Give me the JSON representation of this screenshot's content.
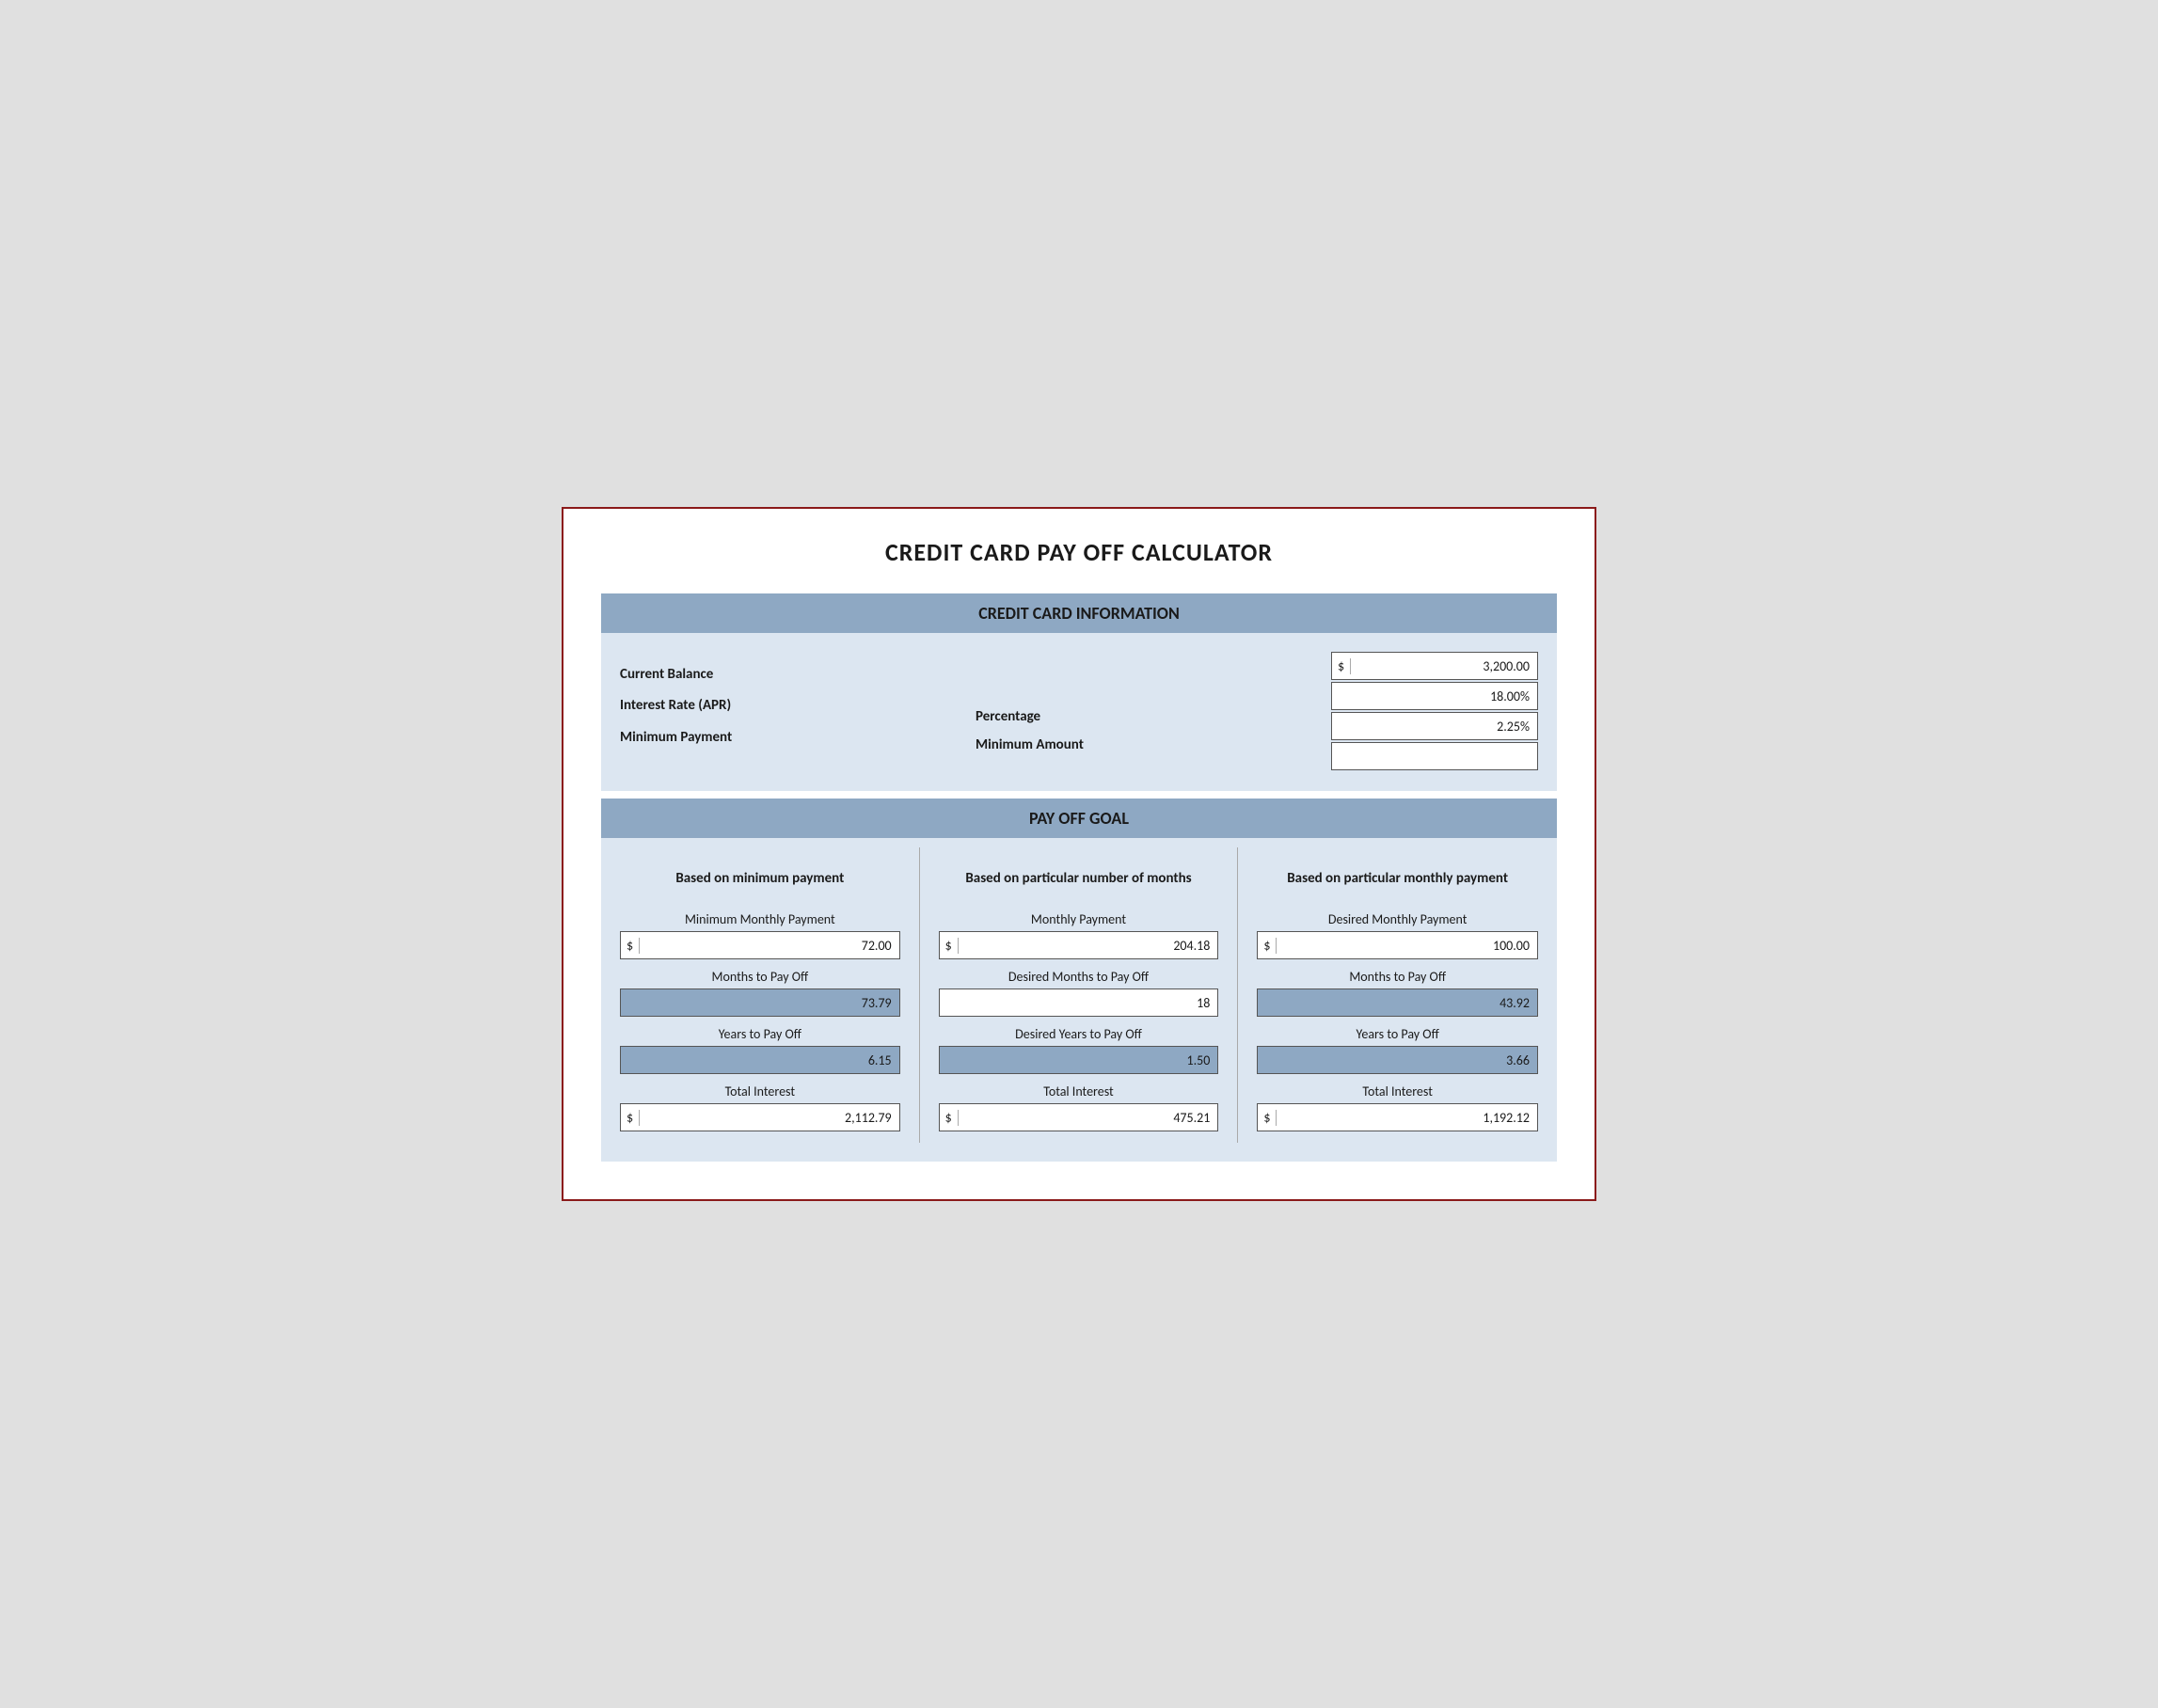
{
  "title": "CREDIT CARD PAY OFF CALCULATOR",
  "credit_card_info": {
    "header": "CREDIT CARD INFORMATION",
    "labels": {
      "current_balance": "Current Balance",
      "interest_rate": "Interest Rate (APR)",
      "minimum_payment": "Minimum Payment"
    },
    "middle_labels": {
      "percentage": "Percentage",
      "minimum_amount": "Minimum Amount"
    },
    "values": {
      "current_balance": "3,200.00",
      "interest_rate": "18.00%",
      "min_payment_pct": "2.25%",
      "min_amount": ""
    }
  },
  "pay_off_goal": {
    "header": "PAY OFF GOAL",
    "col1": {
      "title": "Based on minimum payment",
      "field1_label": "Minimum Monthly Payment",
      "field1_value": "72.00",
      "field2_label": "Months to Pay Off",
      "field2_value": "73.79",
      "field3_label": "Years to Pay Off",
      "field3_value": "6.15",
      "field4_label": "Total Interest",
      "field4_value": "2,112.79"
    },
    "col2": {
      "title": "Based on particular number of months",
      "field1_label": "Monthly Payment",
      "field1_value": "204.18",
      "field2_label": "Desired Months to Pay Off",
      "field2_value": "18",
      "field3_label": "Desired Years to Pay Off",
      "field3_value": "1.50",
      "field4_label": "Total Interest",
      "field4_value": "475.21"
    },
    "col3": {
      "title": "Based on particular monthly payment",
      "field1_label": "Desired Monthly Payment",
      "field1_value": "100.00",
      "field2_label": "Months to Pay Off",
      "field2_value": "43.92",
      "field3_label": "Years to Pay Off",
      "field3_value": "3.66",
      "field4_label": "Total Interest",
      "field4_value": "1,192.12"
    }
  }
}
